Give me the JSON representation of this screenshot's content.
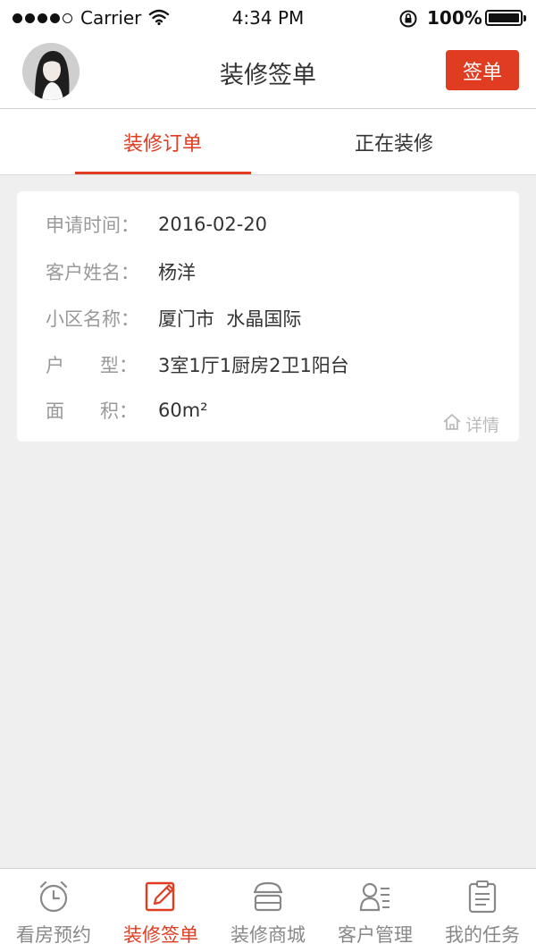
{
  "status_bar": {
    "carrier": "Carrier",
    "time": "4:34 PM",
    "battery": "100%"
  },
  "nav": {
    "title": "装修签单",
    "sign_button": "签单"
  },
  "tabs": [
    {
      "label": "装修订单",
      "active": true
    },
    {
      "label": "正在装修",
      "active": false
    }
  ],
  "order": {
    "rows": [
      {
        "label": "申请时间：",
        "value": "2016-02-20"
      },
      {
        "label": "客户姓名：",
        "value": "杨洋"
      },
      {
        "label": "小区名称：",
        "value": "厦门市  水晶国际"
      },
      {
        "label": "户      型：",
        "value": "3室1厅1厨房2卫1阳台"
      },
      {
        "label": "面      积：",
        "value": "60m²"
      }
    ],
    "detail_label": "详情",
    "detail_icon": "home-icon"
  },
  "tabbar": {
    "items": [
      {
        "label": "看房预约",
        "icon": "alarm-clock-icon",
        "active": false
      },
      {
        "label": "装修签单",
        "icon": "edit-icon",
        "active": true
      },
      {
        "label": "装修商城",
        "icon": "store-icon",
        "active": false
      },
      {
        "label": "客户管理",
        "icon": "contacts-icon",
        "active": false
      },
      {
        "label": "我的任务",
        "icon": "clipboard-icon",
        "active": false
      }
    ]
  },
  "colors": {
    "accent": "#e03c21",
    "background": "#efefef",
    "muted_text": "#999999"
  }
}
